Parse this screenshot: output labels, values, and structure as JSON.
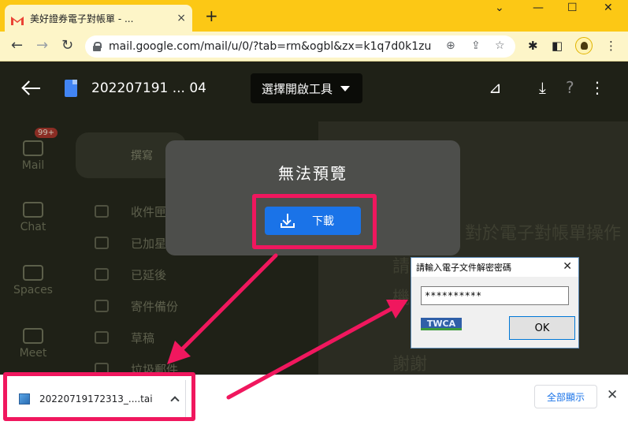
{
  "browser": {
    "tab_title": "美好證券電子對帳單 - ...",
    "tab_close": "×",
    "new_tab": "+",
    "window_controls": {
      "chevron": "⌄",
      "minimize": "—",
      "maximize": "☐",
      "close": "✕"
    },
    "url": "mail.google.com/mail/u/0/?tab=rm&ogbl&zx=k1q7d0k1zuy...",
    "nav": {
      "back": "←",
      "forward": "→",
      "reload": "↻"
    },
    "toolbar_icons": [
      "zoom-icon",
      "share-icon",
      "star-icon",
      "extensions-icon",
      "sidepanel-icon",
      "profile-avatar",
      "menu-icon"
    ]
  },
  "gmail_background": {
    "sidebar": [
      {
        "label": "Mail",
        "badge": "99+"
      },
      {
        "label": "Chat"
      },
      {
        "label": "Spaces"
      },
      {
        "label": "Meet"
      }
    ],
    "compose_label": "撰寫",
    "nav_items": [
      "收件匣",
      "已加星號",
      "已延後",
      "寄件備份",
      "草稿",
      "垃圾郵件"
    ],
    "mail_lines": [
      "對於電子對帳單操作",
      "請",
      "機",
      "謝謝"
    ]
  },
  "viewer": {
    "filename": "202207191 ... 04",
    "open_with_label": "選擇開啟工具",
    "icons": [
      "add-to-drive-icon",
      "download-icon",
      "help-icon",
      "more-vert-icon"
    ]
  },
  "preview_card": {
    "title": "無法預覽",
    "download_label": "下載"
  },
  "password_dialog": {
    "title": "請輸入電子文件解密密碼",
    "close": "✕",
    "password_value": "**********",
    "logo_text": "TWCA",
    "ok_label": "OK"
  },
  "download_shelf": {
    "item_name": "20220719172313_....tai",
    "show_all_label": "全部顯示",
    "close": "✕"
  },
  "annotation_color": "#f0175e"
}
